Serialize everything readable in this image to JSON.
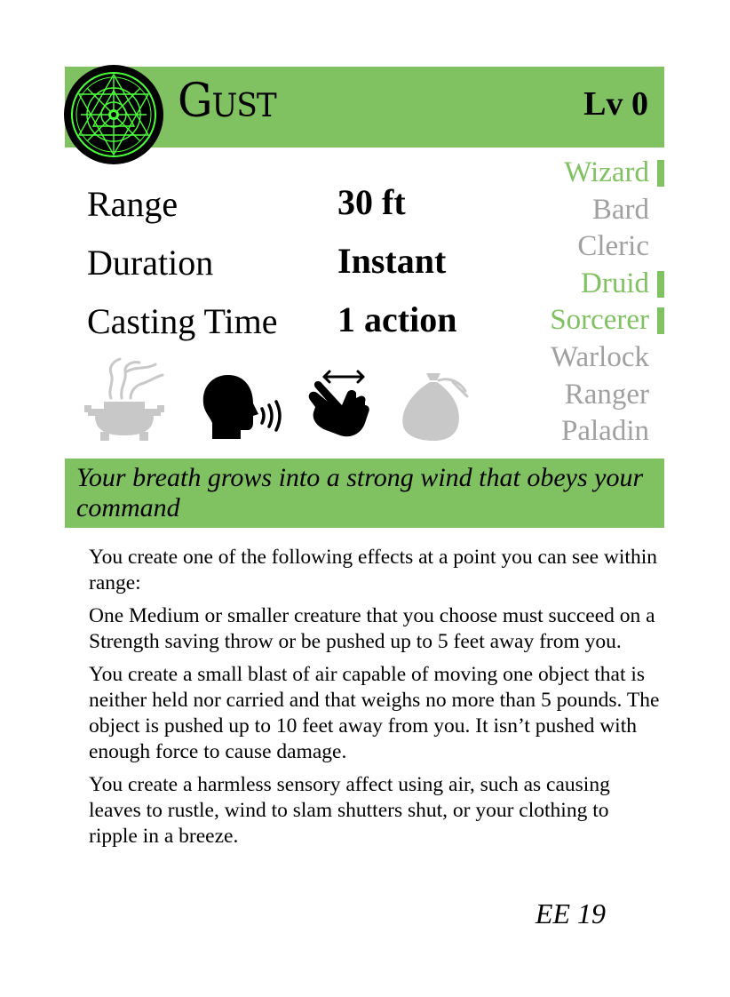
{
  "spell": {
    "name": "Gust",
    "level": "Lv 0"
  },
  "stats": [
    {
      "label": "Range",
      "value": "30 ft"
    },
    {
      "label": "Duration",
      "value": "Instant"
    },
    {
      "label": "Casting Time",
      "value": "1 action"
    }
  ],
  "classes": [
    {
      "name": "Wizard",
      "active": true
    },
    {
      "name": "Bard",
      "active": false
    },
    {
      "name": "Cleric",
      "active": false
    },
    {
      "name": "Druid",
      "active": true
    },
    {
      "name": "Sorcerer",
      "active": true
    },
    {
      "name": "Warlock",
      "active": false
    },
    {
      "name": "Ranger",
      "active": false
    },
    {
      "name": "Paladin",
      "active": false
    }
  ],
  "components": {
    "ritual": {
      "icon": "incense-burner-icon",
      "active": false
    },
    "verbal": {
      "icon": "speaking-head-icon",
      "active": true
    },
    "somatic": {
      "icon": "hand-gesture-icon",
      "active": true
    },
    "material": {
      "icon": "pouch-icon",
      "active": false
    }
  },
  "colors": {
    "accent": "#80c262",
    "inactive": "#a0a0a0"
  },
  "flavor": "Your breath grows into a strong wind that obeys your command",
  "description": [
    "You create one of the following effects at a point you can see within range:",
    "One Medium or smaller creature that you choose must succeed on a Strength saving throw or be pushed up to 5 feet away from you.",
    "You create a small blast of air capable of moving one object that is neither held nor carried and that weighs no more than 5 pounds. The object is pushed up to 10 feet away from you. It isn’t pushed with enough force to cause damage.",
    "You create a harmless sensory affect using air, such as causing leaves to rustle, wind to slam shutters shut, or your clothing to ripple in a breeze."
  ],
  "source": "EE 19"
}
